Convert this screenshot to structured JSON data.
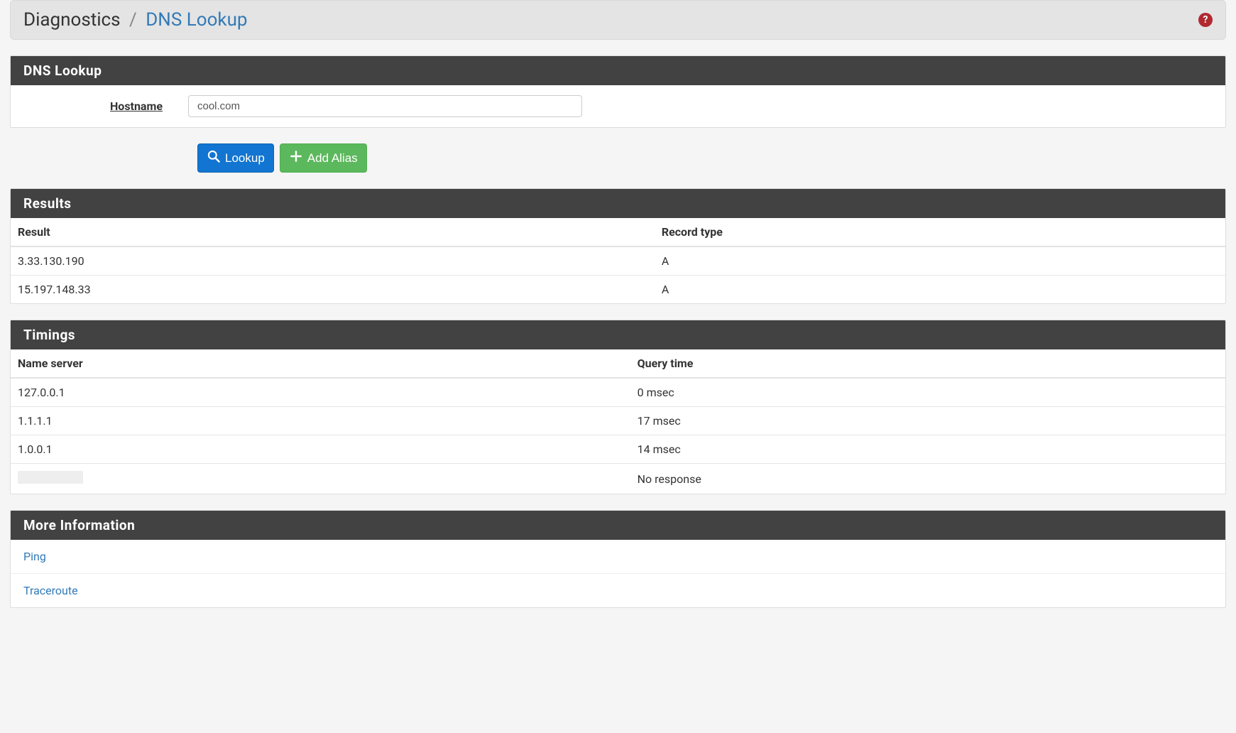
{
  "breadcrumb": {
    "parent": "Diagnostics",
    "separator": "/",
    "current": "DNS Lookup"
  },
  "form": {
    "heading": "DNS Lookup",
    "hostname_label": "Hostname",
    "hostname_value": "cool.com"
  },
  "buttons": {
    "lookup": "Lookup",
    "add_alias": "Add Alias"
  },
  "results": {
    "heading": "Results",
    "headers": {
      "result": "Result",
      "record_type": "Record type"
    },
    "rows": [
      {
        "result": "3.33.130.190",
        "record_type": "A"
      },
      {
        "result": "15.197.148.33",
        "record_type": "A"
      }
    ]
  },
  "timings": {
    "heading": "Timings",
    "headers": {
      "name_server": "Name server",
      "query_time": "Query time"
    },
    "rows": [
      {
        "name_server": "127.0.0.1",
        "query_time": "0 msec"
      },
      {
        "name_server": "1.1.1.1",
        "query_time": "17 msec"
      },
      {
        "name_server": "1.0.0.1",
        "query_time": "14 msec"
      },
      {
        "name_server": "",
        "query_time": "No response"
      }
    ]
  },
  "more_info": {
    "heading": "More Information",
    "links": [
      {
        "label": "Ping"
      },
      {
        "label": "Traceroute"
      }
    ]
  }
}
